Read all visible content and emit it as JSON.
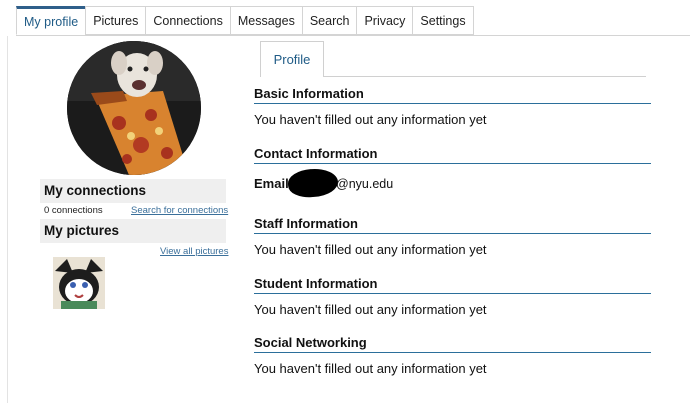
{
  "nav": {
    "tabs": [
      {
        "label": "My profile",
        "active": true
      },
      {
        "label": "Pictures"
      },
      {
        "label": "Connections"
      },
      {
        "label": "Messages"
      },
      {
        "label": "Search"
      },
      {
        "label": "Privacy"
      },
      {
        "label": "Settings"
      }
    ]
  },
  "sidebar": {
    "connections_title": "My connections",
    "connections_count": "0 connections",
    "search_connections_link": "Search for connections",
    "pictures_title": "My pictures",
    "view_all_pictures_link": "View all pictures"
  },
  "profile": {
    "tab_label": "Profile",
    "sections": {
      "basic": {
        "title": "Basic Information",
        "text": "You haven't filled out any information yet"
      },
      "contact": {
        "title": "Contact Information",
        "email_label": "Email",
        "email_domain": "@nyu.edu"
      },
      "staff": {
        "title": "Staff Information",
        "text": "You haven't filled out any information yet"
      },
      "student": {
        "title": "Student Information",
        "text": "You haven't filled out any information yet"
      },
      "social": {
        "title": "Social Networking",
        "text": "You haven't filled out any information yet"
      }
    }
  },
  "colors": {
    "accent": "#2f5f8a",
    "link": "#3a6f9a",
    "section_rule": "#2b6f9b"
  }
}
